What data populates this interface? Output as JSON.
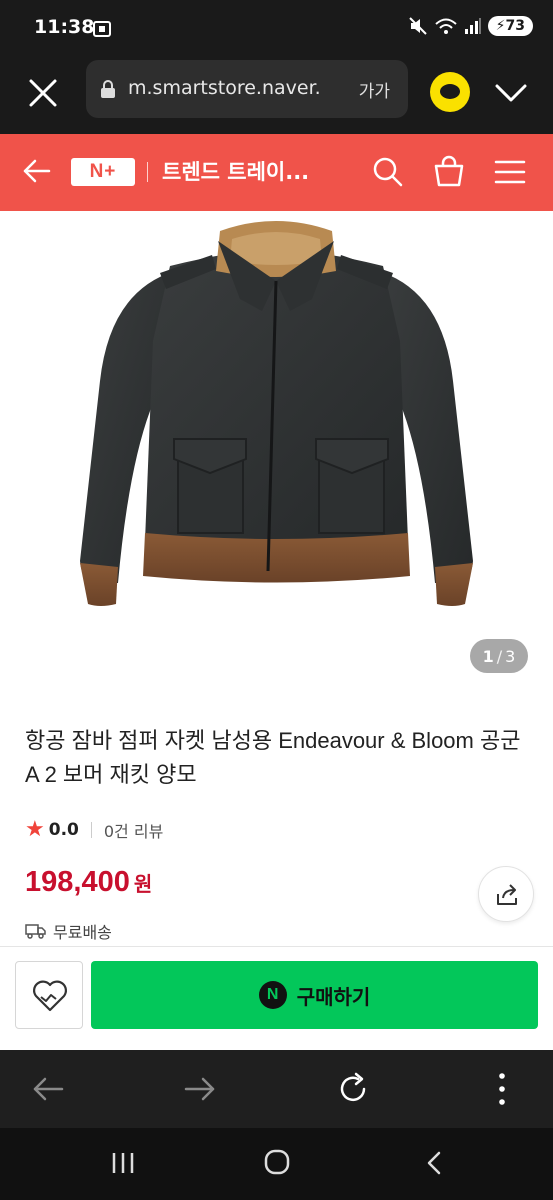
{
  "status_bar": {
    "time": "11:38",
    "battery": "73"
  },
  "browser": {
    "url": "m.smartstore.naver.",
    "font_size_label": "가가"
  },
  "header": {
    "logo_text": "N+",
    "store_name": "트렌드 트레이..."
  },
  "product": {
    "image_counter_current": "1",
    "image_counter_total": "3",
    "title": "항공 잠바 점퍼 자켓 남성용 Endeavour & Bloom 공군 A 2 보머 재킷 양모",
    "rating": "0.0",
    "review_count": "0건 리뷰",
    "price": "198,400",
    "price_unit": "원",
    "shipping": "무료배송"
  },
  "actions": {
    "buy_label": "구매하기",
    "npay_mark": "N"
  },
  "colors": {
    "header_bg": "#f0534a",
    "price": "#c8102e",
    "buy_button": "#03c75a",
    "star": "#f0433a"
  },
  "icons": {
    "status": [
      "screen-record-icon",
      "mute-icon",
      "wifi-icon",
      "signal-icon",
      "battery-icon"
    ],
    "browser": [
      "close-icon",
      "lock-icon",
      "kakaotalk-icon",
      "chevron-down-icon"
    ],
    "header": [
      "back-arrow-icon",
      "search-icon",
      "cart-icon",
      "menu-icon"
    ],
    "toolbar": [
      "back-icon",
      "forward-icon",
      "reload-icon",
      "more-icon"
    ],
    "nav": [
      "recent-apps-icon",
      "home-icon",
      "nav-back-icon"
    ]
  }
}
